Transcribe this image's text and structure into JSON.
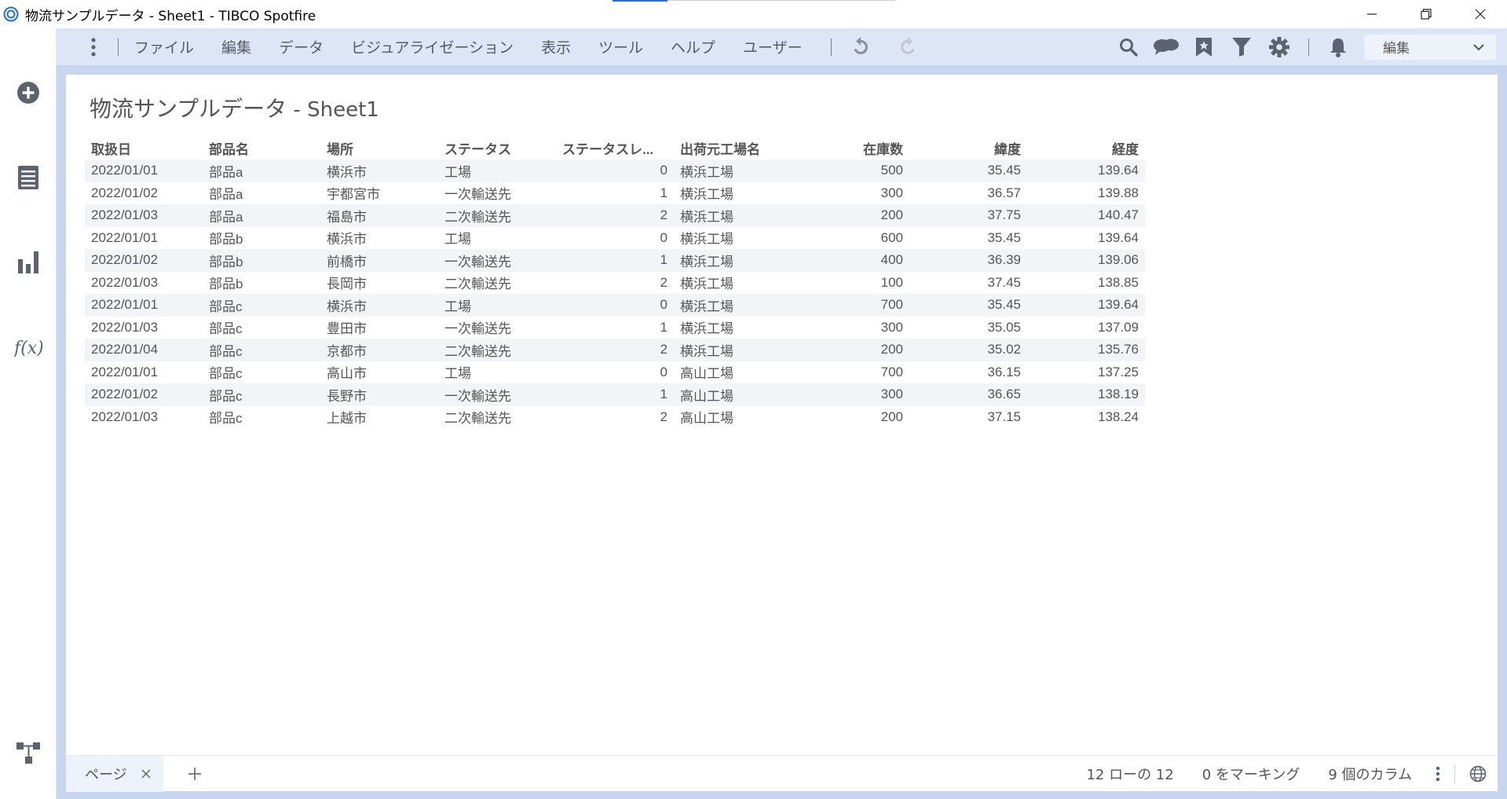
{
  "window": {
    "title": "物流サンプルデータ - Sheet1 - TIBCO Spotfire",
    "controls": [
      "minimize",
      "restore",
      "close"
    ]
  },
  "toolbar": {
    "menus": [
      "ファイル",
      "編集",
      "データ",
      "ビジュアライゼーション",
      "表示",
      "ツール",
      "ヘルプ",
      "ユーザー"
    ],
    "mode_label": "編集"
  },
  "left_rail": [
    "add-icon",
    "data-table-icon",
    "visualization-icon",
    "fx-icon",
    "data-canvas-icon"
  ],
  "content": {
    "title_main": "物流サンプルデータ",
    "title_sep": " - ",
    "title_sheet": "Sheet1",
    "columns": [
      "取扱日",
      "部品名",
      "場所",
      "ステータス",
      "ステータスレ...",
      "出荷元工場名",
      "在庫数",
      "緯度",
      "経度"
    ],
    "rows": [
      [
        "2022/01/01",
        "部品a",
        "横浜市",
        "工場",
        "0",
        "横浜工場",
        "500",
        "35.45",
        "139.64"
      ],
      [
        "2022/01/02",
        "部品a",
        "宇都宮市",
        "一次輸送先",
        "1",
        "横浜工場",
        "300",
        "36.57",
        "139.88"
      ],
      [
        "2022/01/03",
        "部品a",
        "福島市",
        "二次輸送先",
        "2",
        "横浜工場",
        "200",
        "37.75",
        "140.47"
      ],
      [
        "2022/01/01",
        "部品b",
        "横浜市",
        "工場",
        "0",
        "横浜工場",
        "600",
        "35.45",
        "139.64"
      ],
      [
        "2022/01/02",
        "部品b",
        "前橋市",
        "一次輸送先",
        "1",
        "横浜工場",
        "400",
        "36.39",
        "139.06"
      ],
      [
        "2022/01/03",
        "部品b",
        "長岡市",
        "二次輸送先",
        "2",
        "横浜工場",
        "100",
        "37.45",
        "138.85"
      ],
      [
        "2022/01/01",
        "部品c",
        "横浜市",
        "工場",
        "0",
        "横浜工場",
        "700",
        "35.45",
        "139.64"
      ],
      [
        "2022/01/03",
        "部品c",
        "豊田市",
        "一次輸送先",
        "1",
        "横浜工場",
        "300",
        "35.05",
        "137.09"
      ],
      [
        "2022/01/04",
        "部品c",
        "京都市",
        "二次輸送先",
        "2",
        "横浜工場",
        "200",
        "35.02",
        "135.76"
      ],
      [
        "2022/01/01",
        "部品c",
        "高山市",
        "工場",
        "0",
        "高山工場",
        "700",
        "36.15",
        "137.25"
      ],
      [
        "2022/01/02",
        "部品c",
        "長野市",
        "一次輸送先",
        "1",
        "高山工場",
        "300",
        "36.65",
        "138.19"
      ],
      [
        "2022/01/03",
        "部品c",
        "上越市",
        "二次輸送先",
        "2",
        "高山工場",
        "200",
        "37.15",
        "138.24"
      ]
    ]
  },
  "bottom": {
    "page_tab": "ページ",
    "row_count": "12 ローの 12",
    "marked": "0 をマーキング",
    "columns_count": "9 個のカラム"
  },
  "colors": {
    "frame": "#c7d5ee",
    "toolbar": "#dde6f6",
    "accent": "#1e6fd9"
  }
}
